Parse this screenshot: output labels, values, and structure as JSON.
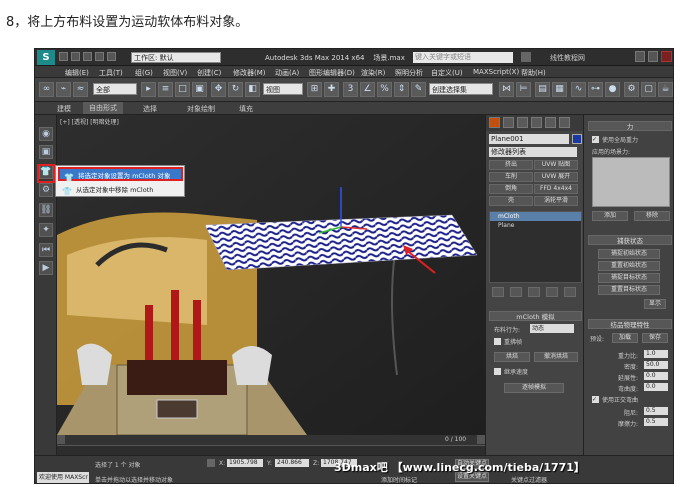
{
  "caption": "8，将上方布料设置为运动软体布料对象。",
  "title_bar": {
    "workspace": "工作区: 默认",
    "app_title": "Autodesk 3ds Max  2014 x64",
    "file": "场景.max",
    "search_placeholder": "键入关键字或短语",
    "brand": "线性教程网"
  },
  "menu": [
    "编辑(E)",
    "工具(T)",
    "组(G)",
    "视图(V)",
    "创建(C)",
    "修改器(M)",
    "动画(A)",
    "图形编辑器(D)",
    "渲染(R)",
    "照明分析",
    "自定义(U)",
    "MAXScript(X)",
    "帮助(H)"
  ],
  "toolbar": {
    "filter": "全部",
    "view": "视图",
    "selset": "创建选择集"
  },
  "ribbon": [
    "建模",
    "自由形式",
    "选择",
    "对象绘制",
    "填充"
  ],
  "viewport_label": "[+] [透视] [明暗处理]",
  "popup": {
    "set_object": "将选定对象设置为 mCloth 对象",
    "remove_object": "从选定对象中移除 mCloth"
  },
  "command_panel": {
    "object_name": "Plane001",
    "modifier_list": "修改器列表",
    "buttons": [
      "挤出",
      "UVW 贴图",
      "车削",
      "UVW 展开",
      "倒角",
      "FFD 4x4x4",
      "壳",
      "涡轮平滑"
    ],
    "stack": [
      "mCloth",
      "Plane"
    ],
    "rollout_title": "mCloth 模拟",
    "cloth_behavior_label": "布料行为:",
    "cloth_behavior_value": "动态",
    "reset_label": "重拂帧",
    "bake": "烘焙",
    "undo_bake": "撤消烘焙",
    "continue_speed": "继承速度",
    "simulate": "逐帧模拟"
  },
  "force_panel": {
    "title": "力",
    "use_global_gravity": "使用全局重力",
    "applied_fields": "应用的场景力:",
    "add": "添加",
    "remove": "移除",
    "capture_title": "捕获状态",
    "capture_buttons": [
      "捕捉初始状态",
      "重置初始状态",
      "捕捉目标状态",
      "重置目标状态"
    ],
    "show": "显示",
    "physics_title": "纺品物理特性",
    "preset": "预设:",
    "load": "加载",
    "save": "保存",
    "props": [
      {
        "label": "重力比:",
        "value": "1.0"
      },
      {
        "label": "密度:",
        "value": "50.0"
      },
      {
        "label": "延展性:",
        "value": "0.0"
      },
      {
        "label": "弯曲度:",
        "value": "0.0"
      }
    ],
    "use_orthotropic": "使用正交弯曲",
    "damping_label": "阻尼:",
    "damping_value": "0.5",
    "friction_label": "摩擦力:",
    "friction_value": "0.5"
  },
  "timeline": {
    "frame": "0 / 100",
    "frame_display": "0 / 100"
  },
  "status": {
    "welcome": "欢迎使用 MAXScr",
    "selected": "选择了 1 个 对象",
    "hint": "单击并拖动以选择并移动对象",
    "x_label": "X:",
    "x": "1905.798",
    "y_label": "Y:",
    "y": "240.866",
    "z_label": "Z:",
    "z": "1708.747",
    "add_time_tag": "添加时间标记",
    "auto_key": "自动关键点",
    "set_key": "设置关键点",
    "key_filter": "关键点过滤器"
  },
  "watermark": "3Dmax吧 【www.linecg.com/tieba/1771】"
}
